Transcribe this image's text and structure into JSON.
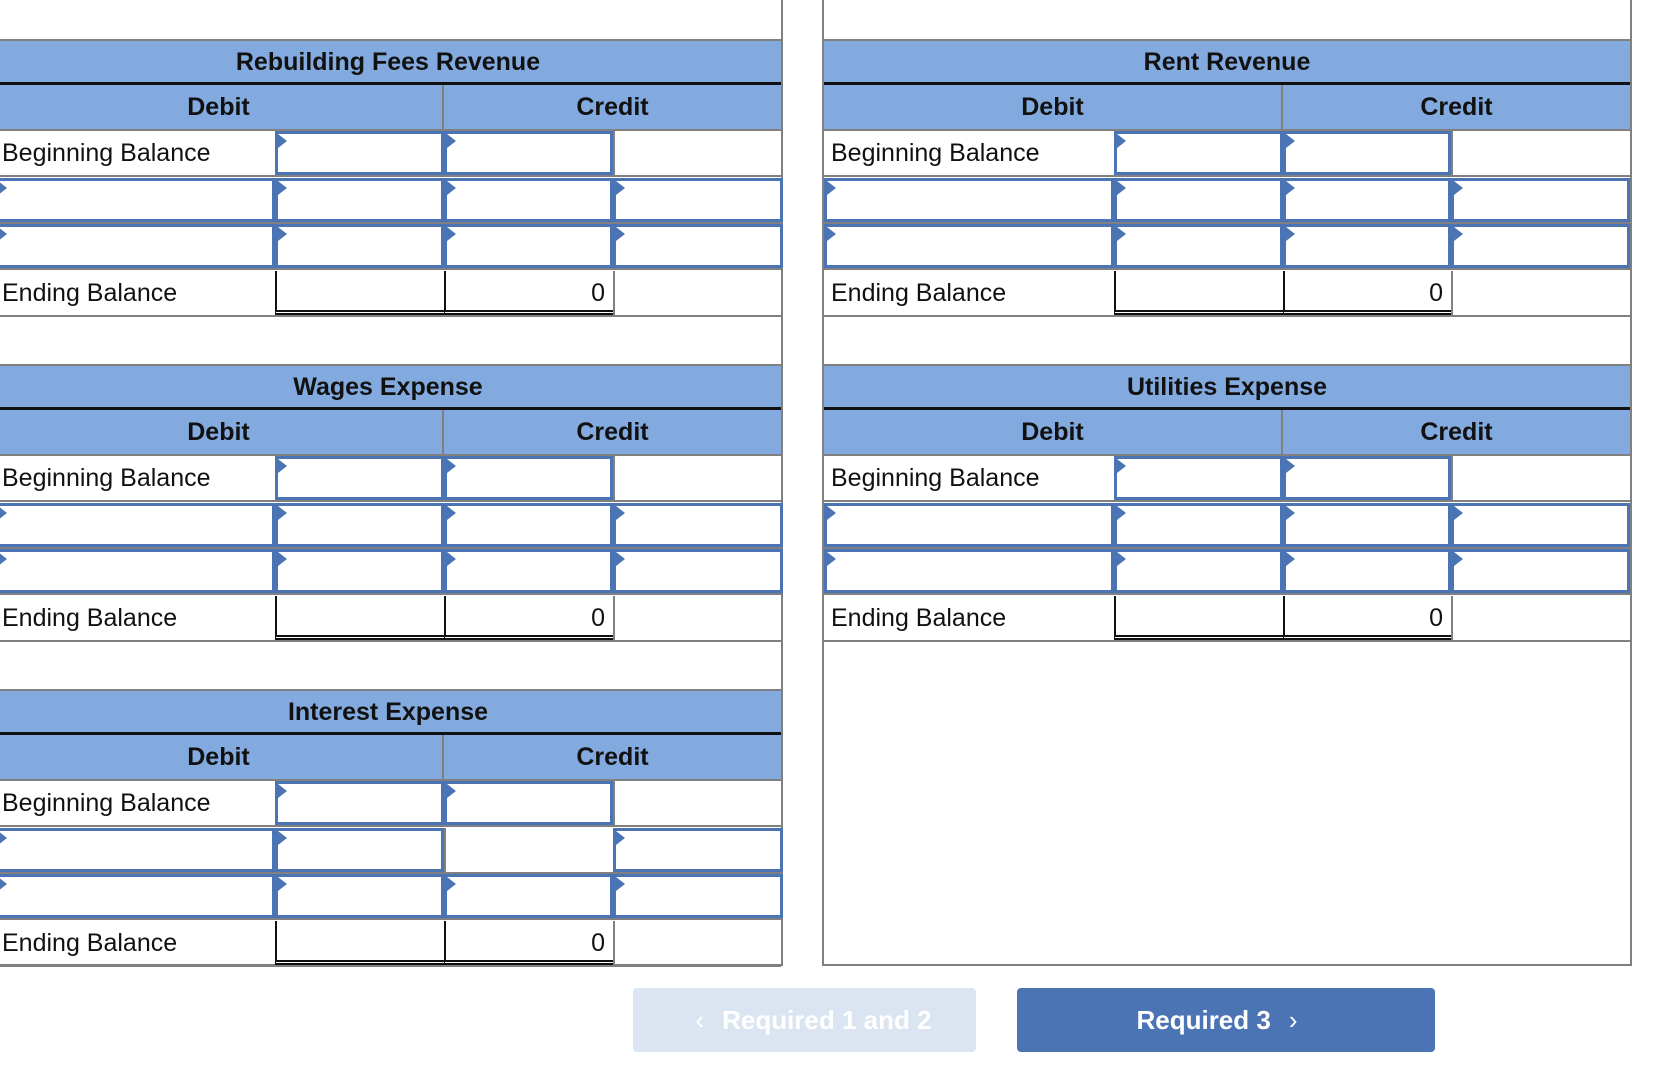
{
  "accounts": [
    {
      "title": "Rebuilding Fees Revenue",
      "debit": "Debit",
      "credit": "Credit",
      "rows": [
        {
          "label": "Beginning Balance",
          "cells": [
            "text",
            "input",
            "input",
            "blank"
          ]
        },
        {
          "label": "",
          "cells": [
            "input",
            "input",
            "input",
            "input"
          ]
        },
        {
          "label": "",
          "cells": [
            "input",
            "input",
            "input",
            "input"
          ]
        },
        {
          "label": "Ending Balance",
          "cells": [
            "text",
            "total",
            "total",
            "blank"
          ],
          "debit_total": "",
          "credit_total": "0"
        }
      ]
    },
    {
      "title": "Rent Revenue",
      "debit": "Debit",
      "credit": "Credit",
      "rows": [
        {
          "label": "Beginning Balance",
          "cells": [
            "text",
            "input",
            "input",
            "blank"
          ]
        },
        {
          "label": "",
          "cells": [
            "input",
            "input",
            "input",
            "input"
          ]
        },
        {
          "label": "",
          "cells": [
            "input",
            "input",
            "input",
            "input"
          ]
        },
        {
          "label": "Ending Balance",
          "cells": [
            "text",
            "total",
            "total",
            "blank"
          ],
          "debit_total": "",
          "credit_total": "0"
        }
      ]
    },
    {
      "title": "Wages Expense",
      "debit": "Debit",
      "credit": "Credit",
      "rows": [
        {
          "label": "Beginning Balance",
          "cells": [
            "text",
            "input",
            "input",
            "blank"
          ]
        },
        {
          "label": "",
          "cells": [
            "input",
            "input",
            "input",
            "input"
          ]
        },
        {
          "label": "",
          "cells": [
            "input",
            "input",
            "input",
            "input"
          ]
        },
        {
          "label": "Ending Balance",
          "cells": [
            "text",
            "total",
            "total",
            "blank"
          ],
          "debit_total": "",
          "credit_total": "0"
        }
      ]
    },
    {
      "title": "Utilities Expense",
      "debit": "Debit",
      "credit": "Credit",
      "rows": [
        {
          "label": "Beginning Balance",
          "cells": [
            "text",
            "input",
            "input",
            "blank"
          ]
        },
        {
          "label": "",
          "cells": [
            "input",
            "input",
            "input",
            "input"
          ]
        },
        {
          "label": "",
          "cells": [
            "input",
            "input",
            "input",
            "input"
          ]
        },
        {
          "label": "Ending Balance",
          "cells": [
            "text",
            "total",
            "total",
            "blank"
          ],
          "debit_total": "",
          "credit_total": "0"
        }
      ]
    },
    {
      "title": "Interest Expense",
      "debit": "Debit",
      "credit": "Credit",
      "rows": [
        {
          "label": "Beginning Balance",
          "cells": [
            "text",
            "input",
            "input",
            "blank"
          ]
        },
        {
          "label": "",
          "cells": [
            "input",
            "input",
            "blank",
            "input"
          ]
        },
        {
          "label": "",
          "cells": [
            "input",
            "input",
            "input",
            "input"
          ]
        },
        {
          "label": "Ending Balance",
          "cells": [
            "text",
            "total",
            "total",
            "blank"
          ],
          "debit_total": "",
          "credit_total": "0"
        }
      ]
    }
  ],
  "nav": {
    "prev_label": "Required 1 and 2",
    "next_label": "Required 3",
    "prev_icon": "chevron-left-icon",
    "next_icon": "chevron-right-icon",
    "prev_enabled": false
  },
  "colors": {
    "header": "#82aadf",
    "input_border": "#4a74b4",
    "button": "#4a74b4",
    "button_disabled": "#dbe4f1"
  }
}
